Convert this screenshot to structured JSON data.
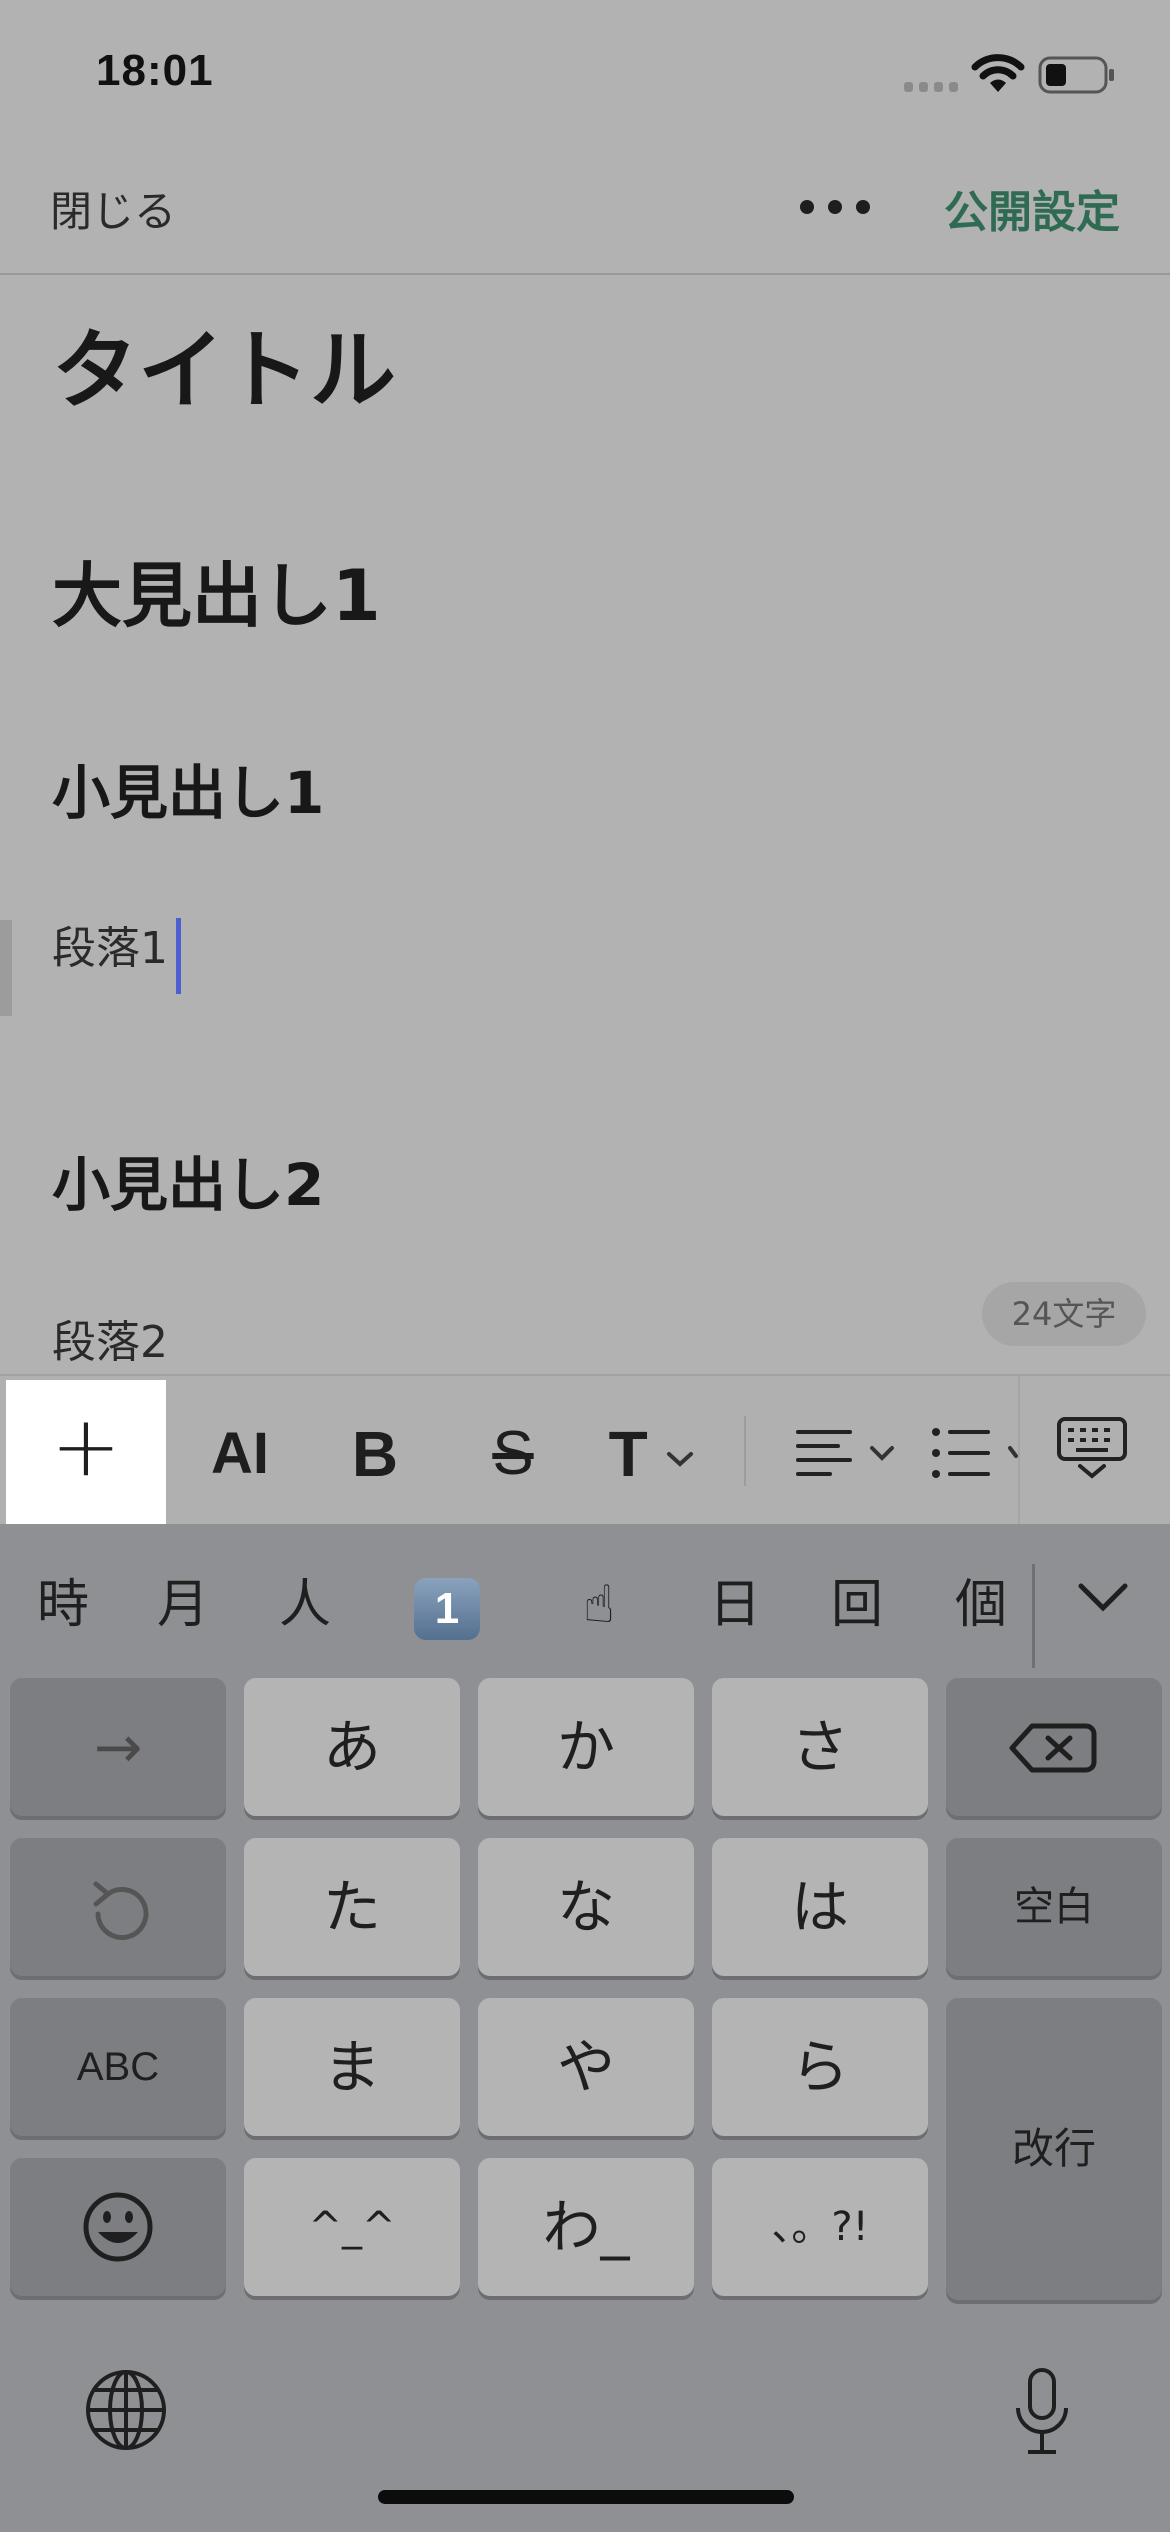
{
  "status": {
    "time": "18:01"
  },
  "nav": {
    "close_label": "閉じる",
    "publish_label": "公開設定"
  },
  "editor": {
    "title": "タイトル",
    "heading1": "大見出し1",
    "subheading1": "小見出し1",
    "paragraph1": "段落1",
    "subheading2": "小見出し2",
    "paragraph2": "段落2",
    "char_count": "24文字"
  },
  "toolbar": {
    "add_label": "+",
    "ai_label": "AI",
    "bold_label": "B",
    "strike_label": "S",
    "text_style_label": "T"
  },
  "keyboard": {
    "candidates": [
      "時",
      "月",
      "人",
      "1",
      "☝",
      "日",
      "回",
      "個"
    ],
    "keys": {
      "next": "→",
      "a": "あ",
      "ka": "か",
      "sa": "さ",
      "ta": "た",
      "na": "な",
      "ha": "は",
      "space": "空白",
      "abc": "ABC",
      "ma": "ま",
      "ya": "や",
      "ra": "ら",
      "enter": "改行",
      "kaomoji": "^_^",
      "wa": "わ_",
      "punct": "、。?!"
    }
  },
  "colors": {
    "accent": "#2f6b52",
    "caret": "#4b5fd0",
    "keyboard_bg": "#8f9094"
  }
}
